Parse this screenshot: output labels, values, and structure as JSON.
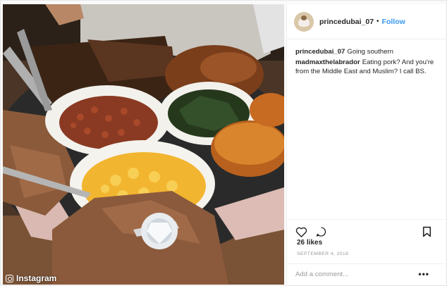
{
  "post": {
    "username": "princedubai_07",
    "separator": "•",
    "follow_label": "Follow",
    "comments": [
      {
        "user": "princedubai_07",
        "text": "Going southern"
      },
      {
        "user": "madmaxthelabrador",
        "text": "Eating pork? And you're from the Middle East and Muslim? I call BS."
      }
    ],
    "likes": "26 likes",
    "date": "SEPTEMBER 4, 2018",
    "add_comment_placeholder": "Add a comment...",
    "more_label": "•••"
  },
  "watermark": {
    "label": "Instagram"
  },
  "icons": {
    "like": "heart-icon",
    "comment": "comment-bubble-icon",
    "save": "bookmark-icon",
    "more": "more-options-icon",
    "watermark": "instagram-glyph-icon"
  },
  "colors": {
    "follow": "#3897f0",
    "muted": "#999999",
    "text": "#262626"
  }
}
